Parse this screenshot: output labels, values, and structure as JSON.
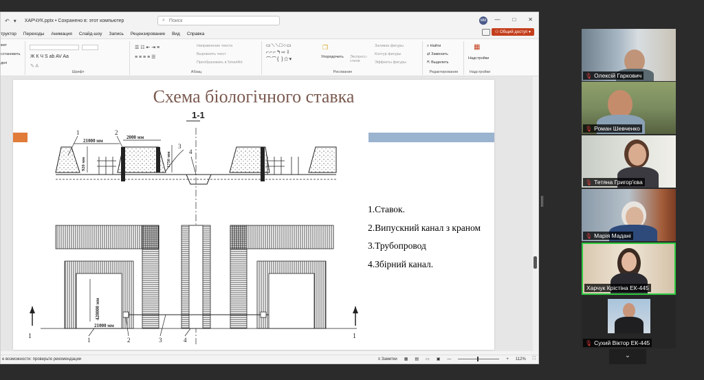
{
  "app": {
    "doc_title": "ХАРЧУК.pptx • Сохранено в: этот компьютер",
    "search_placeholder": "Поиск",
    "avatar_initials": "ММ",
    "window_buttons": [
      "—",
      "□",
      "✕"
    ]
  },
  "menu": {
    "items": [
      "труктор",
      "Переходы",
      "Анимация",
      "Слайд-шоу",
      "Запись",
      "Рецензирование",
      "Вид",
      "Справка"
    ],
    "share_label": "Общий доступ"
  },
  "ribbon": {
    "left_items": [
      "жет",
      "сстановить",
      "дел"
    ],
    "groups": {
      "font": "Шрифт",
      "paragraph": "Абзац",
      "drawing": "Рисование",
      "editing": "Редактирование",
      "addins": "Надстройки"
    },
    "para_items": [
      "Направление текста",
      "Выровнять текст",
      "Преобразовать в SmartArt"
    ],
    "arrange": "Упорядочить",
    "styles": "Экспресс-стили",
    "shape_items": [
      "Заливка фигуры",
      "Контур фигуры",
      "Эффекты фигуры"
    ],
    "edit_items": [
      "Найти",
      "Заменить",
      "Выделить"
    ],
    "addins_button": "Надстройки"
  },
  "slide": {
    "title": "Схема біологічного ставка",
    "section_label": "1-1",
    "legend": [
      "1.Ставок.",
      "2.Випускний канал з краном",
      "3.Трубопровод",
      "4.Збірний канал."
    ],
    "drawing_labels": {
      "dim_21000_top": "21000 мм",
      "dim_2000": "2000 мм",
      "dim_920": "920 мм",
      "dim_1750": "1750 мм",
      "dim_420000": "420000 мм",
      "dim_21000_bottom": "21000 мм",
      "num1": "1",
      "num2": "2",
      "num3": "3",
      "num4": "4"
    }
  },
  "status": {
    "left": "е возможности: проверьте рекомендации",
    "notes": "Заметки",
    "zoom": "112%"
  },
  "participants": [
    {
      "name": "Олексій Гаркович",
      "muted": true,
      "active": false
    },
    {
      "name": "Роман Шевченко",
      "muted": true,
      "active": false
    },
    {
      "name": "Тетяна Григор'єва",
      "muted": true,
      "active": false
    },
    {
      "name": "Марія Мадані",
      "muted": true,
      "active": false
    },
    {
      "name": "Харчук Крістіна ЕК-445",
      "muted": false,
      "active": true
    },
    {
      "name": "Сухий Віктор ЕК-445",
      "muted": true,
      "active": false
    }
  ],
  "colors": {
    "share": "#c43e1c",
    "title_text": "#7a5a50",
    "orange_bar": "#e07b39",
    "blue_bar": "#9ab3cf",
    "active_border": "#2ecc40"
  }
}
